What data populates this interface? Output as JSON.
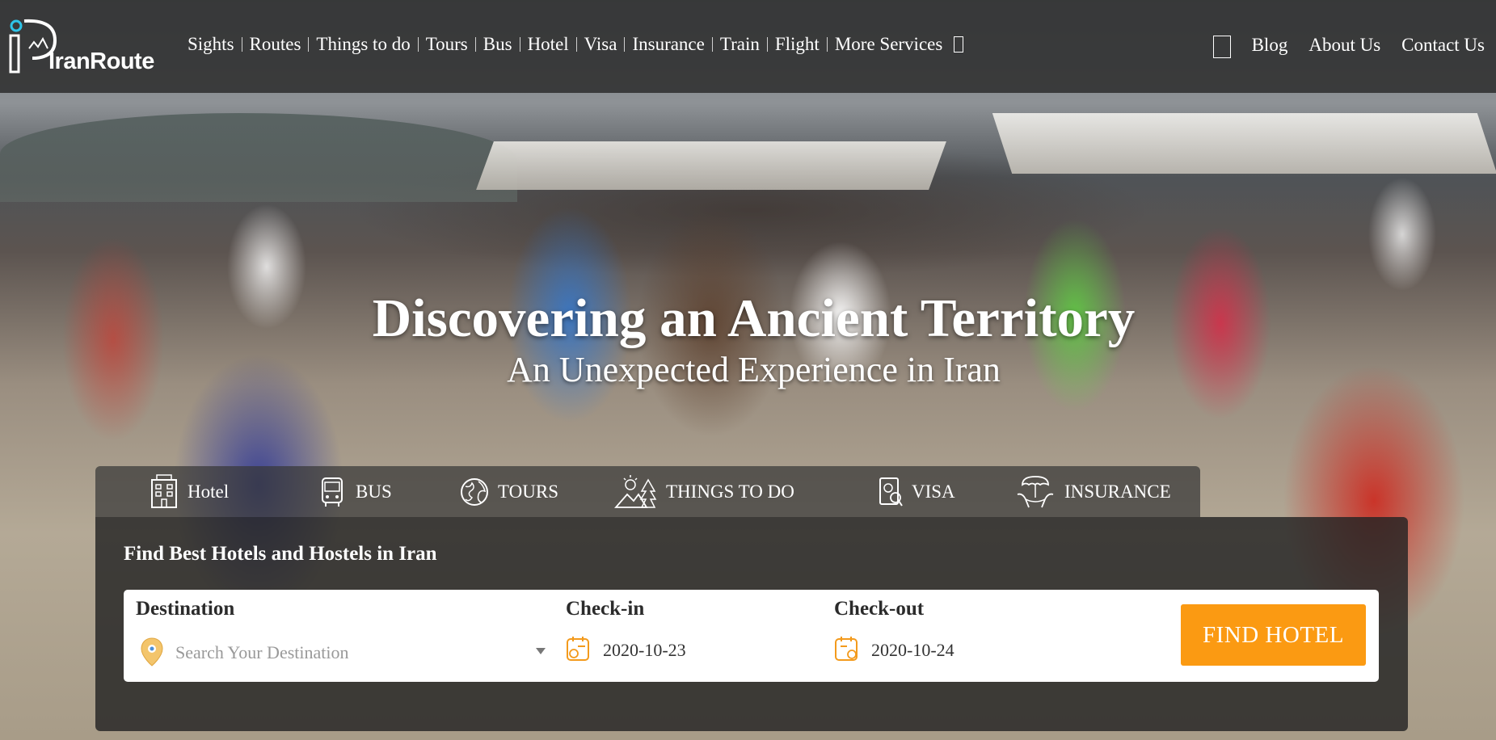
{
  "brand": {
    "name": "IranRoute"
  },
  "nav": {
    "items": [
      {
        "label": "Sights"
      },
      {
        "label": "Routes"
      },
      {
        "label": "Things to do"
      },
      {
        "label": "Tours"
      },
      {
        "label": "Bus"
      },
      {
        "label": "Hotel"
      },
      {
        "label": "Visa"
      },
      {
        "label": "Insurance"
      },
      {
        "label": "Train"
      },
      {
        "label": "Flight"
      },
      {
        "label": "More Services"
      }
    ],
    "right": [
      {
        "label": "Blog"
      },
      {
        "label": "About Us"
      },
      {
        "label": "Contact Us"
      }
    ]
  },
  "hero": {
    "title": "Discovering an Ancient Territory",
    "subtitle": "An Unexpected Experience in Iran"
  },
  "search": {
    "tabs": [
      {
        "label": "Hotel",
        "icon": "hotel-icon",
        "active": true
      },
      {
        "label": "BUS",
        "icon": "bus-icon"
      },
      {
        "label": "TOURS",
        "icon": "globe-icon"
      },
      {
        "label": "THINGS TO DO",
        "icon": "activities-icon"
      },
      {
        "label": "VISA",
        "icon": "passport-icon"
      },
      {
        "label": "INSURANCE",
        "icon": "insurance-icon"
      }
    ],
    "panel_title": "Find Best Hotels and Hostels in Iran",
    "destination": {
      "label": "Destination",
      "placeholder": "Search Your Destination"
    },
    "checkin": {
      "label": "Check-in",
      "value": "2020-10-23"
    },
    "checkout": {
      "label": "Check-out",
      "value": "2020-10-24"
    },
    "submit_label": "FIND HOTEL"
  },
  "colors": {
    "accent": "#fb9a12",
    "header_bg": "#282828",
    "panel_bg": "#232323"
  }
}
